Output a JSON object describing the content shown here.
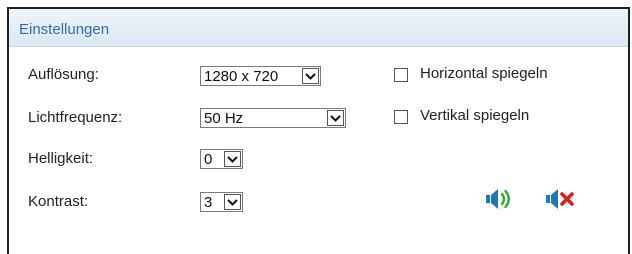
{
  "panel": {
    "title": "Einstellungen"
  },
  "resolution": {
    "label": "Auflösung:",
    "value": "1280 x 720"
  },
  "light_frequency": {
    "label": "Lichtfrequenz:",
    "value": "50 Hz"
  },
  "brightness": {
    "label": "Helligkeit:",
    "value": "0"
  },
  "contrast": {
    "label": "Kontrast:",
    "value": "3"
  },
  "mirror_horizontal": {
    "label": "Horizontal spiegeln",
    "checked": false
  },
  "mirror_vertical": {
    "label": "Vertikal spiegeln",
    "checked": false
  },
  "icons": {
    "sound_on": "speaker-on-icon",
    "sound_off": "speaker-mute-icon",
    "accent_blue": "#1d78b8",
    "accent_green": "#3aa33a",
    "accent_red": "#d9201f"
  }
}
